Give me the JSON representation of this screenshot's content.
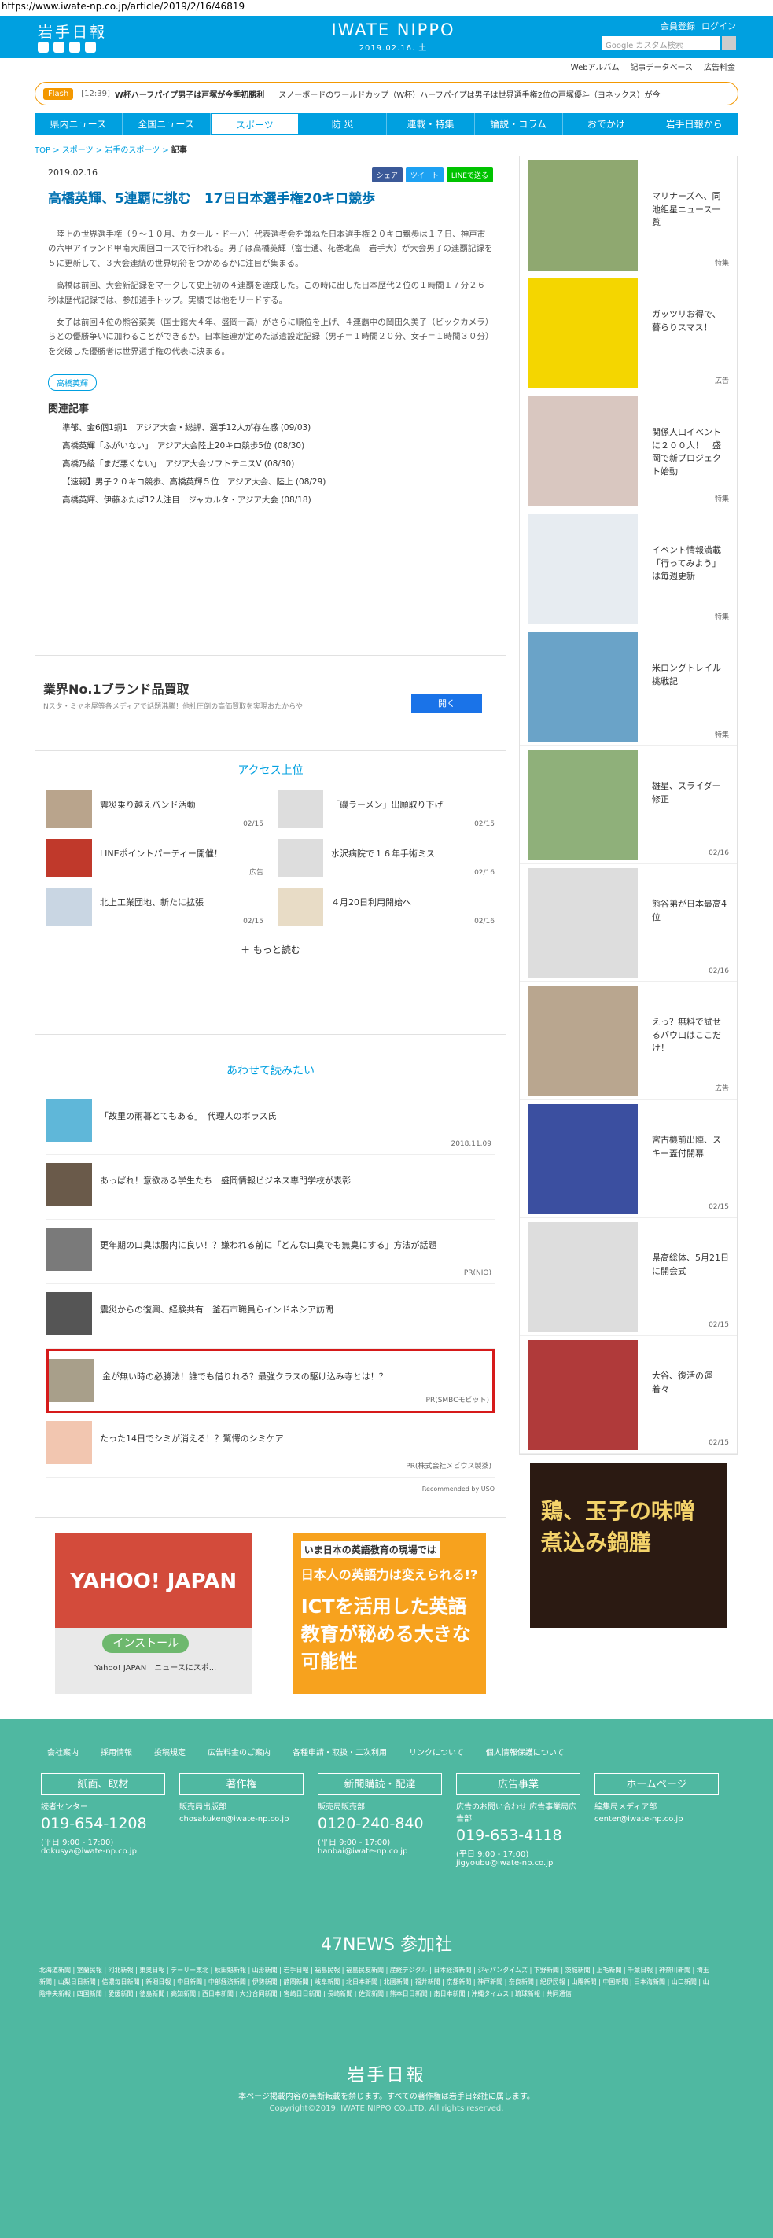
{
  "url": "https://www.iwate-np.co.jp/article/2019/2/16/46819",
  "header": {
    "logo": "岩手日報",
    "brand": "IWATE NIPPO",
    "date": "2019.02.16. 土",
    "member": "会員登録",
    "login": "ログイン",
    "search_placeholder": "Google カスタム検索"
  },
  "subnav": [
    "Webアルバム",
    "記事データベース",
    "広告料金"
  ],
  "flash": {
    "tag": "Flash",
    "time": "[12:39]",
    "title": "W杯ハーフパイプ男子は戸塚が今季初勝利",
    "text": "スノーボードのワールドカップ（W杯）ハーフパイプは男子は世界選手権2位の戸塚優斗（ヨネックス）が今"
  },
  "gnav": [
    "県内ニュース",
    "全国ニュース",
    "スポーツ",
    "防 災",
    "連載・特集",
    "論説・コラム",
    "おでかけ",
    "岩手日報から"
  ],
  "breadcrumb": {
    "a": "TOP",
    "b": "スポーツ",
    "c": "岩手のスポーツ",
    "d": "記事"
  },
  "article": {
    "date": "2019.02.16",
    "share": [
      "シェア",
      "ツイート",
      "LINEで送る"
    ],
    "title": "高橋英輝、5連覇に挑む　17日日本選手権20キロ競歩",
    "paras": [
      "陸上の世界選手権（９～１０月、カタール・ドーハ）代表選考会を兼ねた日本選手権２０キロ競歩は１７日、神戸市の六甲アイランド甲南大周回コースで行われる。男子は高橋英輝（富士通、花巻北高－岩手大）が大会男子の連覇記録を５に更新して、３大会連続の世界切符をつかめるかに注目が集まる。",
      "高橋は前回、大会新記録をマークして史上初の４連覇を達成した。この時に出した日本歴代２位の１時間１７分２６秒は歴代記録では、参加選手トップ。実績では他をリードする。",
      "女子は前回４位の熊谷菜美（国士館大４年、盛岡一高）がさらに順位を上げ、４連覇中の岡田久美子（ビックカメラ）らとの優勝争いに加わることができるか。日本陸連が定めた派遣設定記録（男子＝１時間２０分、女子＝１時間３０分）を突破した優勝者は世界選手権の代表に決まる。"
    ],
    "tag": "高橋英輝",
    "related_head": "関連記事",
    "related": [
      "準郁、金6個1銅1　アジア大会・総評、選手12人が存在感 (09/03)",
      "高橋英輝「ふがいない」　アジア大会陸上20キロ競歩5位 (08/30)",
      "高橋乃綾「まだ悪くない」　アジア大会ソフトテニスV (08/30)",
      "【速報】男子２０キロ競歩、高橋英輝５位　アジア大会、陸上 (08/29)",
      "高橋英輝、伊藤ふたば12人注目　ジャカルタ・アジア大会 (08/18)"
    ]
  },
  "ad1": {
    "title": "業界No.1ブランド品買取",
    "sub": "Nスタ・ミヤネ屋等各メディアで話題沸騰！他社圧倒の高価買取を実現おたからや",
    "btn": "開く"
  },
  "ranking": {
    "title": "アクセス上位",
    "items": [
      {
        "t": "震災乗り越えバンド活動",
        "d": "02/15"
      },
      {
        "t": "「磯ラーメン」出願取り下げ",
        "d": "02/15"
      },
      {
        "t": "LINEポイントパーティー開催！",
        "d": "広告"
      },
      {
        "t": "水沢病院で１６年手術ミス",
        "d": "02/16"
      },
      {
        "t": "北上工業団地、新たに拡張",
        "d": "02/15"
      },
      {
        "t": "４月20日利用開始へ",
        "d": "02/16"
      }
    ],
    "more": "もっと読む"
  },
  "also": {
    "title": "あわせて読みたい",
    "items": [
      {
        "t": "「故里の雨暮とてもある」　代理人のボラス氏",
        "m": "2018.11.09"
      },
      {
        "t": "あっぱれ！意欲ある学生たち　盛岡情報ビジネス専門学校が表彰",
        "m": ""
      },
      {
        "t": "更年期の口臭は腸内に良い！？嫌われる前に「どんな口臭でも無臭にする」方法が話題",
        "m": "PR(NIO)"
      },
      {
        "t": "震災からの復興、経験共有　釜石市職員らインドネシア訪問",
        "m": ""
      },
      {
        "t": "金が無い時の必勝法！誰でも借りれる？最強クラスの駆け込み寺とは！？",
        "m": "PR(SMBCモビット)"
      },
      {
        "t": "たった14日でシミが消える！？驚愕のシミケア",
        "m": "PR(株式会社メビウス製薬)"
      }
    ],
    "powered": "Recommended by USO"
  },
  "ads": {
    "yahoo": "YAHOO! JAPAN",
    "install": "インストール",
    "yapp": "Yahoo! JAPAN　ニュースにスポ...",
    "chieru_a": "いま日本の英語教育の現場では",
    "chieru_b": "日本人の英語力は変えられる!?",
    "chieru_c": "ICTを活用した英語教育が秘める大きな可能性"
  },
  "side": [
    {
      "t": "マリナーズへ、同池組星ニュース一覧",
      "m": "特集"
    },
    {
      "t": "ガッツリお得で、暮らりスマス！",
      "m": "広告"
    },
    {
      "t": "関係人口イベントに２００人！　盛岡で新プロジェクト始動",
      "m": "特集"
    },
    {
      "t": "イベント情報満載「行ってみよう」は毎週更新",
      "m": "特集"
    },
    {
      "t": "米ロングトレイル挑戦記",
      "m": "特集"
    },
    {
      "t": "雄星、スライダー修正",
      "m": "02/16"
    },
    {
      "t": "熊谷弟が日本最高4位",
      "m": "02/16"
    },
    {
      "t": "えっ？無料で試せるパウ口はここだけ！",
      "m": "広告"
    },
    {
      "t": "宮古機前出陣、スキー蓋付開幕",
      "m": "02/15"
    },
    {
      "t": "県高総体、5月21日に開会式",
      "m": "02/15"
    },
    {
      "t": "大谷、復活の運着々",
      "m": "02/15"
    }
  ],
  "side_ad": "鶏、玉子の味噌煮込み鍋膳",
  "footer": {
    "links": [
      "会社案内",
      "採用情報",
      "投稿規定",
      "広告料金のご案内",
      "各種申請・取扱・二次利用",
      "リンクについて",
      "個人情報保護について"
    ],
    "cols": [
      {
        "h": "紙面、取材",
        "l": "読者センター",
        "tel": "019-654-1208",
        "hr": "(平日 9:00 - 17:00)",
        "mail": "dokusya@iwate-np.co.jp"
      },
      {
        "h": "著作権",
        "l": "販売局出版部",
        "tel": "",
        "hr": "",
        "mail": "chosakuken@iwate-np.co.jp"
      },
      {
        "h": "新聞購読・配達",
        "l": "販売局販売部",
        "tel": "0120-240-840",
        "hr": "(平日 9:00 - 17:00)",
        "mail": "hanbai@iwate-np.co.jp"
      },
      {
        "h": "広告事業",
        "l": "広告のお問い合わせ 広告事業局広告部",
        "tel": "019-653-4118",
        "hr": "(平日 9:00 - 17:00)",
        "mail": "jigyoubu@iwate-np.co.jp"
      },
      {
        "h": "ホームページ",
        "l": "編集局メディア部",
        "tel": "",
        "hr": "",
        "mail": "center@iwate-np.co.jp"
      }
    ],
    "n47": "47NEWS 参加社",
    "papers": "北海道新聞 | 室蘭民報 | 河北新報 | 東奥日報 | デーリー東北 | 秋田魁新報 | 山形新聞 | 岩手日報 | 福島民報 | 福島民友新聞 | 産経デジタル | 日本経済新聞 | ジャパンタイムズ | 下野新聞 | 茨城新聞 | 上毛新聞 | 千葉日報 | 神奈川新聞 | 埼玉新聞 | 山梨日日新聞 | 信濃毎日新聞 | 新潟日報 | 中日新聞 | 中部経済新聞 | 伊勢新聞 | 静岡新聞 | 岐阜新聞 | 北日本新聞 | 北國新聞 | 福井新聞 | 京都新聞 | 神戸新聞 | 奈良新聞 | 紀伊民報 | 山陽新聞 | 中国新聞 | 日本海新聞 | 山口新聞 | 山陰中央新報 | 四国新聞 | 愛媛新聞 | 徳島新聞 | 高知新聞 | 西日本新聞 | 大分合同新聞 | 宮崎日日新聞 | 長崎新聞 | 佐賀新聞 | 熊本日日新聞 | 南日本新聞 | 沖縄タイムス | 琉球新報 | 共同通信",
    "logo": "岩手日報",
    "notice": "本ページ掲載内容の無断転載を禁じます。すべての著作権は岩手日報社に属します。",
    "copyright": "Copyright©2019, IWATE NIPPO CO.,LTD. All rights reserved."
  }
}
